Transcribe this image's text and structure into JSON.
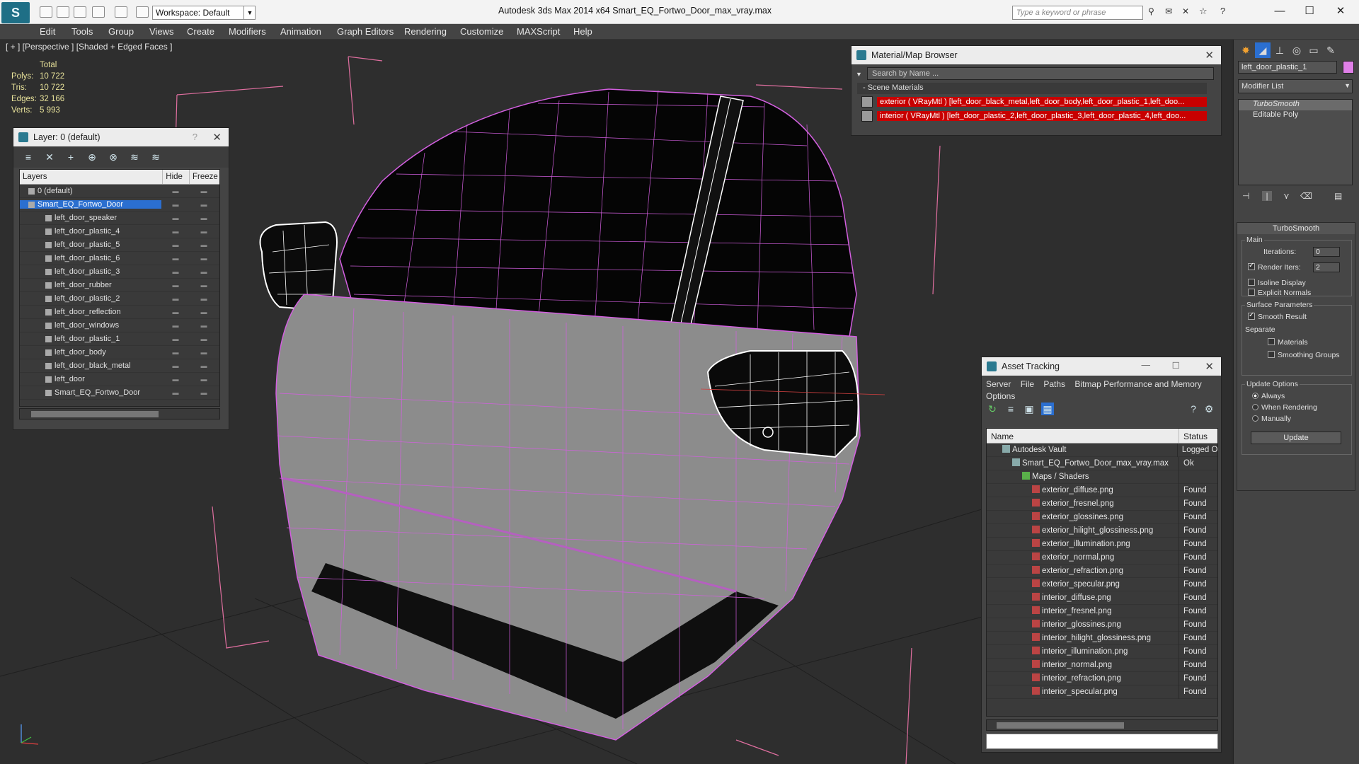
{
  "window": {
    "app_title": "Autodesk 3ds Max  2014 x64      Smart_EQ_Fortwo_Door_max_vray.max",
    "workspace": "Workspace: Default",
    "search_placeholder": "Type a keyword or phrase"
  },
  "menu": [
    "Edit",
    "Tools",
    "Group",
    "Views",
    "Create",
    "Modifiers",
    "Animation",
    "Graph Editors",
    "Rendering",
    "Customize",
    "MAXScript",
    "Help"
  ],
  "viewport": {
    "label": "[ + ] [Perspective ] [Shaded + Edged Faces ]",
    "stats": {
      "header": "Total",
      "rows": [
        {
          "k": "Polys:",
          "v": "10 722"
        },
        {
          "k": "Tris:",
          "v": "10 722"
        },
        {
          "k": "Edges:",
          "v": "32 166"
        },
        {
          "k": "Verts:",
          "v": "5 993"
        }
      ]
    }
  },
  "layer_panel": {
    "title": "Layer: 0 (default)",
    "help": "?",
    "columns": {
      "layers": "Layers",
      "hide": "Hide",
      "freeze": "Freeze"
    },
    "rows": [
      {
        "name": "0 (default)",
        "level": 0
      },
      {
        "name": "Smart_EQ_Fortwo_Door",
        "level": 0,
        "selected": true
      },
      {
        "name": "left_door_speaker",
        "level": 1
      },
      {
        "name": "left_door_plastic_4",
        "level": 1
      },
      {
        "name": "left_door_plastic_5",
        "level": 1
      },
      {
        "name": "left_door_plastic_6",
        "level": 1
      },
      {
        "name": "left_door_plastic_3",
        "level": 1
      },
      {
        "name": "left_door_rubber",
        "level": 1
      },
      {
        "name": "left_door_plastic_2",
        "level": 1
      },
      {
        "name": "left_door_reflection",
        "level": 1
      },
      {
        "name": "left_door_windows",
        "level": 1
      },
      {
        "name": "left_door_plastic_1",
        "level": 1
      },
      {
        "name": "left_door_body",
        "level": 1
      },
      {
        "name": "left_door_black_metal",
        "level": 1
      },
      {
        "name": "left_door",
        "level": 1
      },
      {
        "name": "Smart_EQ_Fortwo_Door",
        "level": 1
      }
    ]
  },
  "material_browser": {
    "title": "Material/Map Browser",
    "search_placeholder": "Search by Name ...",
    "section": "- Scene Materials",
    "materials": [
      "exterior ( VRayMtl ) [left_door_black_metal,left_door_body,left_door_plastic_1,left_doo...",
      "interior ( VRayMtl ) [left_door_plastic_2,left_door_plastic_3,left_door_plastic_4,left_doo..."
    ]
  },
  "asset_tracking": {
    "title": "Asset Tracking",
    "menus": [
      "Server",
      "File",
      "Paths",
      "Bitmap Performance and Memory",
      "Options"
    ],
    "columns": {
      "name": "Name",
      "status": "Status"
    },
    "rows": [
      {
        "name": "Autodesk Vault",
        "status": "Logged O",
        "level": 0
      },
      {
        "name": "Smart_EQ_Fortwo_Door_max_vray.max",
        "status": "Ok",
        "level": 1
      },
      {
        "name": "Maps / Shaders",
        "status": "",
        "level": 2
      },
      {
        "name": "exterior_diffuse.png",
        "status": "Found",
        "level": 3
      },
      {
        "name": "exterior_fresnel.png",
        "status": "Found",
        "level": 3
      },
      {
        "name": "exterior_glossines.png",
        "status": "Found",
        "level": 3
      },
      {
        "name": "exterior_hilight_glossiness.png",
        "status": "Found",
        "level": 3
      },
      {
        "name": "exterior_illumination.png",
        "status": "Found",
        "level": 3
      },
      {
        "name": "exterior_normal.png",
        "status": "Found",
        "level": 3
      },
      {
        "name": "exterior_refraction.png",
        "status": "Found",
        "level": 3
      },
      {
        "name": "exterior_specular.png",
        "status": "Found",
        "level": 3
      },
      {
        "name": "interior_diffuse.png",
        "status": "Found",
        "level": 3
      },
      {
        "name": "interior_fresnel.png",
        "status": "Found",
        "level": 3
      },
      {
        "name": "interior_glossines.png",
        "status": "Found",
        "level": 3
      },
      {
        "name": "interior_hilight_glossiness.png",
        "status": "Found",
        "level": 3
      },
      {
        "name": "interior_illumination.png",
        "status": "Found",
        "level": 3
      },
      {
        "name": "interior_normal.png",
        "status": "Found",
        "level": 3
      },
      {
        "name": "interior_refraction.png",
        "status": "Found",
        "level": 3
      },
      {
        "name": "interior_specular.png",
        "status": "Found",
        "level": 3
      }
    ]
  },
  "command_panel": {
    "object_name": "left_door_plastic_1",
    "object_color": "#e080e8",
    "modifier_list": "Modifier List",
    "stack": [
      "TurboSmooth",
      "Editable Poly"
    ],
    "turbosmooth": {
      "title": "TurboSmooth",
      "main": "Main",
      "iterations_label": "Iterations:",
      "iterations": "0",
      "render_iters_label": "Render Iters:",
      "render_iters": "2",
      "isoline": "Isoline Display",
      "explicit_normals": "Explicit Normals",
      "surface_params": "Surface Parameters",
      "smooth_result": "Smooth Result",
      "separate": "Separate",
      "materials": "Materials",
      "smoothing_groups": "Smoothing Groups",
      "update_options": "Update Options",
      "always": "Always",
      "when_rendering": "When Rendering",
      "manually": "Manually",
      "update_button": "Update"
    }
  },
  "colors": {
    "wire": "#d35fe0",
    "selection": "#2b6fd0",
    "missing_material": "#c80000"
  }
}
